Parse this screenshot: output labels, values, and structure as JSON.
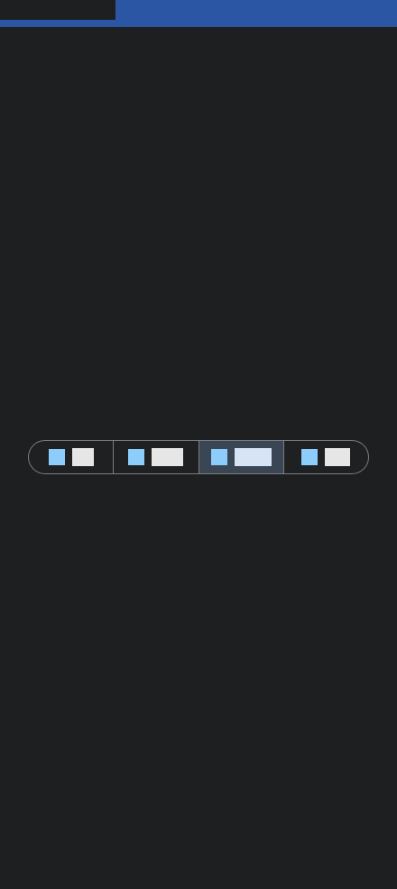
{
  "segmented_control": {
    "segments": [
      {
        "icon": "square-icon",
        "label": ""
      },
      {
        "icon": "square-icon",
        "label": ""
      },
      {
        "icon": "square-icon",
        "label": "",
        "selected": true
      },
      {
        "icon": "square-icon",
        "label": ""
      }
    ]
  },
  "colors": {
    "background": "#1e1f20",
    "top_bar": "#2b56a4",
    "segment_border": "#7b7e82",
    "segment_selected_bg": "#3a4654",
    "icon_color": "#8ccdfc",
    "label_placeholder": "#e6e6e6",
    "label_selected_placeholder": "#d6e4f6"
  }
}
